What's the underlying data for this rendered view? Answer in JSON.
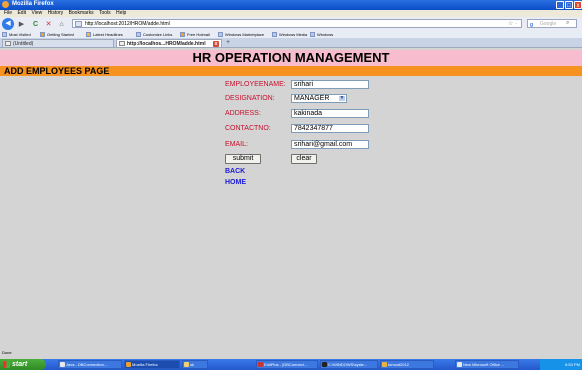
{
  "window": {
    "title": "Mozilla Firefox",
    "min": "_",
    "max": "□",
    "close": "x"
  },
  "menu": [
    "File",
    "Edit",
    "View",
    "History",
    "Bookmarks",
    "Tools",
    "Help"
  ],
  "nav": {
    "back": "◀",
    "forward": "▶",
    "reload": "C",
    "stop": "✕",
    "home": "⌂",
    "url": "http://localhost:2012/HROM/adde.html",
    "star": "☆ ·",
    "search_placeholder": "Google",
    "search_logo": "g"
  },
  "bookmarks": [
    "Most Visited",
    "Getting Started",
    "Latest Headlines",
    "Customize Links",
    "Free Hotmail",
    "Windows Marketplace",
    "Windows Media",
    "Windows"
  ],
  "tabs": [
    {
      "label": "(Untitled)"
    },
    {
      "label": "http://localhos...HROM/adde.html"
    }
  ],
  "newtab": "+",
  "page": {
    "heading": "HR OPERATION MANAGEMENT",
    "subheading": "ADD EMPLOYEES PAGE",
    "fields": {
      "employeename_label": "EMPLOYEENAME:",
      "employeename_value": "srihari",
      "designation_label": "DESIGNATION:",
      "designation_value": "MANAGER",
      "address_label": "ADDRESS:",
      "address_value": "kakinada",
      "contactno_label": "CONTACTNO:",
      "contactno_value": "7842347877",
      "email_label": "EMAIL:",
      "email_value": "srihari@gmail.com"
    },
    "submit_label": "submit",
    "clear_label": "clear",
    "back_link": "BACK",
    "home_link": "HOME"
  },
  "status": "Done",
  "taskbar": {
    "start": "start",
    "items": [
      "Java - DBConnection...",
      "Mozilla Firefox",
      "sk",
      "EditPlus - [DBConnect...",
      "C:\\WINDOWS\\syste...",
      "tomcat2012",
      "New Microsoft Office ..."
    ],
    "clock": "6:53 PM"
  }
}
